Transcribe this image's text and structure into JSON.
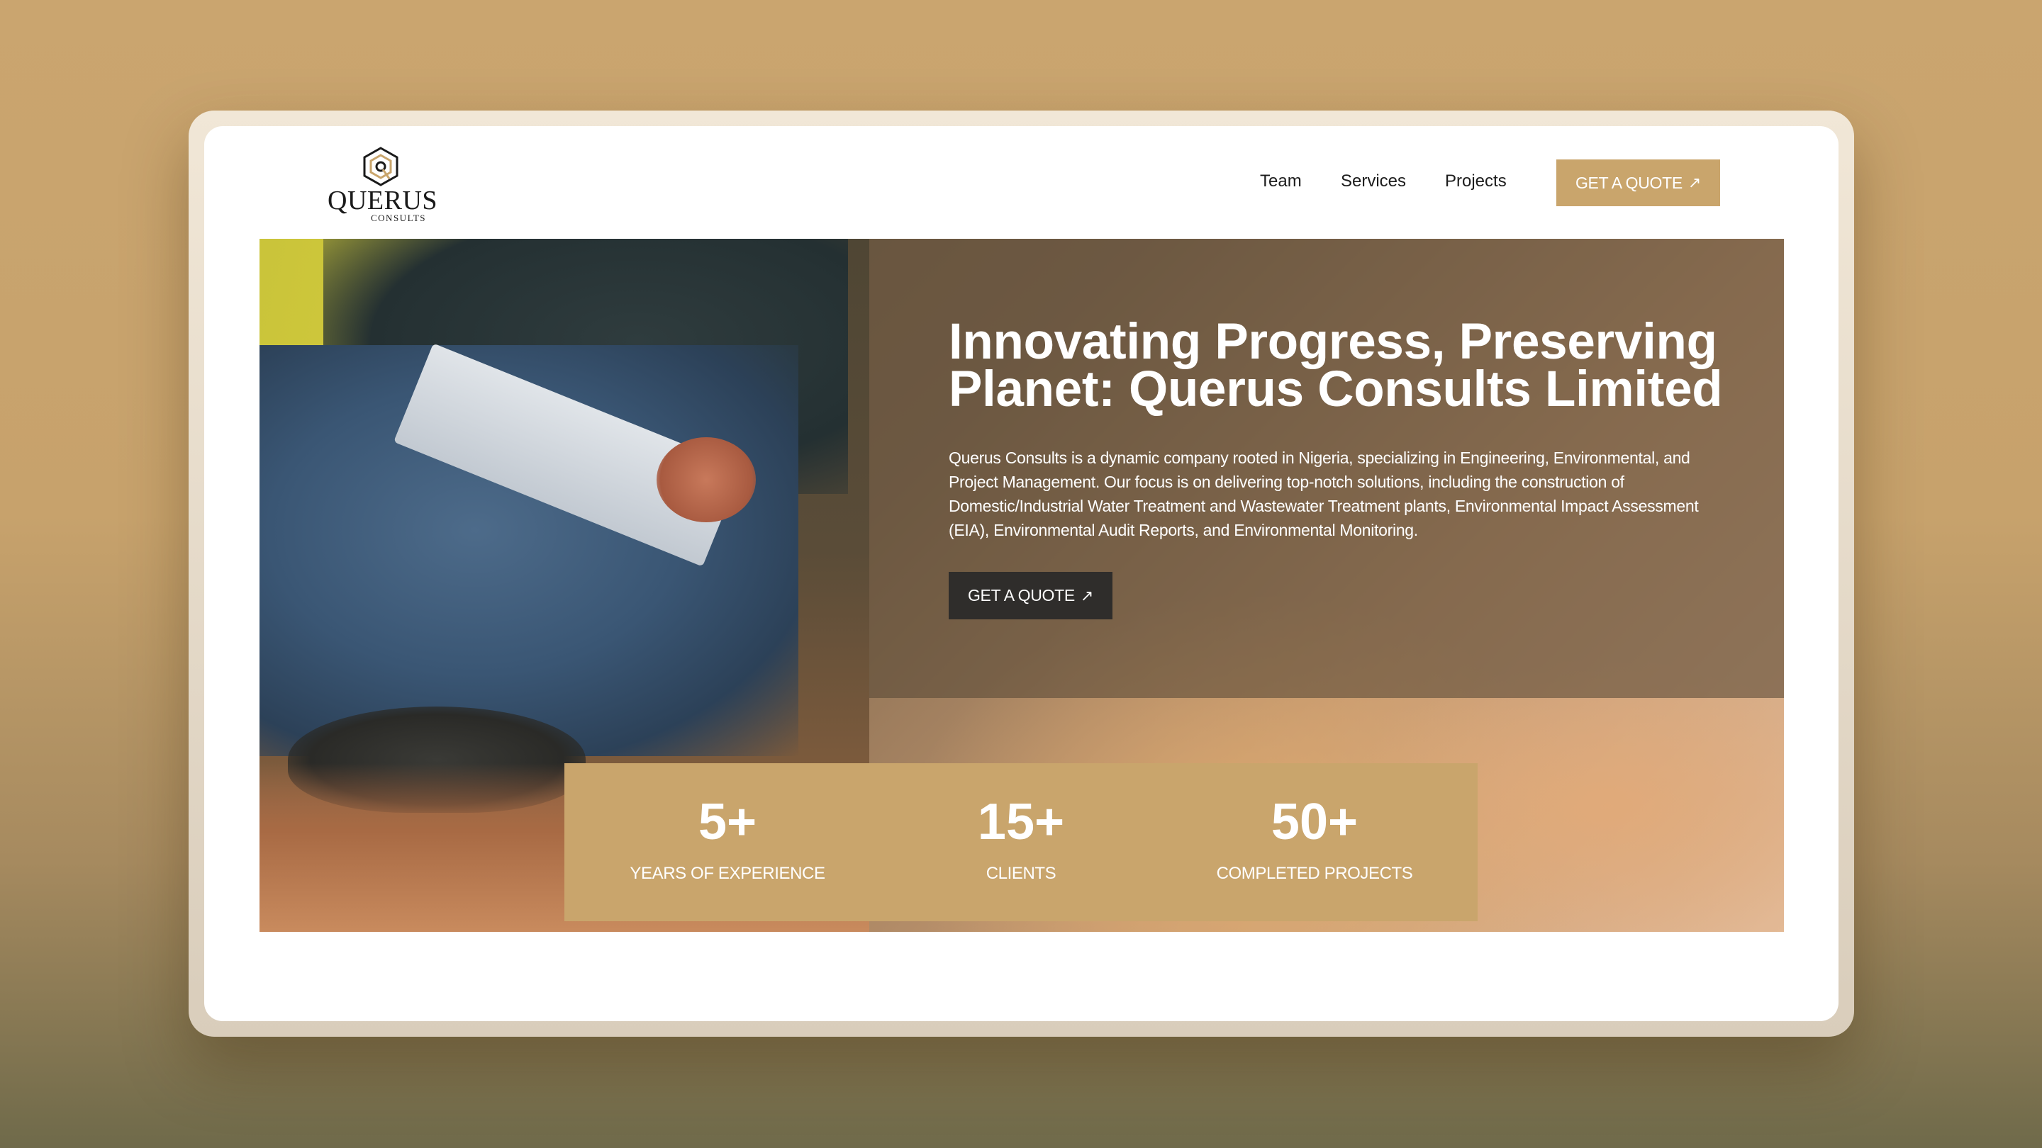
{
  "brand": {
    "name": "QUERUS",
    "sub": "CONSULTS"
  },
  "nav": {
    "items": [
      {
        "label": "Team"
      },
      {
        "label": "Services"
      },
      {
        "label": "Projects"
      }
    ],
    "cta_label": "GET A QUOTE",
    "cta_icon": "arrow-up-right-icon"
  },
  "hero": {
    "title": "Innovating Progress, Preserving Planet: Querus Consults Limited",
    "description": "Querus Consults is a dynamic company rooted in Nigeria, specializing in Engineering, Environmental, and Project Management. Our focus is on delivering top-notch solutions, including the construction of Domestic/Industrial Water Treatment and Wastewater Treatment plants, Environmental Impact Assessment (EIA), Environmental Audit Reports, and Environmental Monitoring.",
    "cta_label": "GET A QUOTE"
  },
  "stats": [
    {
      "value": "5+",
      "label": "YEARS OF EXPERIENCE"
    },
    {
      "value": "15+",
      "label": "CLIENTS"
    },
    {
      "value": "50+",
      "label": "COMPLETED PROJECTS"
    }
  ],
  "colors": {
    "accent": "#c9a56c",
    "dark_button": "#2f2d2b",
    "page_background": "#caa56f"
  }
}
